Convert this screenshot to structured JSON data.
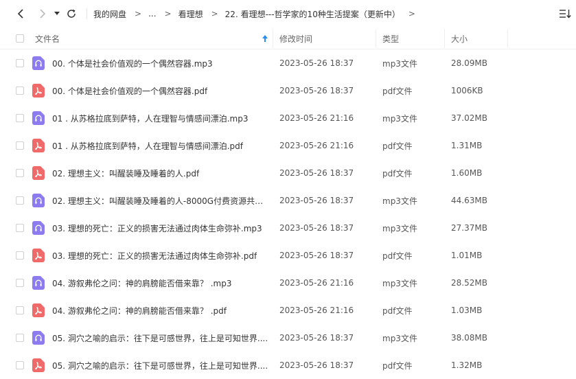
{
  "breadcrumb": {
    "root": "我的网盘",
    "ellipsis": "...",
    "parent": "看理想",
    "current": "22. 看理想---哲学家的10种生活提案（更新中）"
  },
  "columns": {
    "name": "文件名",
    "modified": "修改时间",
    "type": "类型",
    "size": "大小"
  },
  "colors": {
    "audio_icon": "#8c7cf0",
    "pdf_icon": "#f06a6a",
    "sort_arrow": "#2a8cf0"
  },
  "files": [
    {
      "name": "00. 个体是社会价值观的一个偶然容器.mp3",
      "modified": "2023-05-26 18:37",
      "type": "mp3文件",
      "size": "28.09MB",
      "icon": "audio-file-icon"
    },
    {
      "name": "00. 个体是社会价值观的一个偶然容器.pdf",
      "modified": "2023-05-26 18:37",
      "type": "pdf文件",
      "size": "1006KB",
      "icon": "pdf-file-icon"
    },
    {
      "name": "01 . 从苏格拉底到萨特，人在理智与情感间漂泊.mp3",
      "modified": "2023-05-26 21:16",
      "type": "mp3文件",
      "size": "37.02MB",
      "icon": "audio-file-icon"
    },
    {
      "name": "01 . 从苏格拉底到萨特，人在理智与情感间漂泊.pdf",
      "modified": "2023-05-26 21:16",
      "type": "pdf文件",
      "size": "1.31MB",
      "icon": "pdf-file-icon"
    },
    {
      "name": "02. 理想主义：叫醒装睡及睡着的人.pdf",
      "modified": "2023-05-26 18:37",
      "type": "pdf文件",
      "size": "1.60MB",
      "icon": "pdf-file-icon"
    },
    {
      "name": "02. 理想主义：叫醒装睡及睡着的人-8000G付费资源共享...",
      "modified": "2023-05-26 18:37",
      "type": "mp3文件",
      "size": "44.63MB",
      "icon": "audio-file-icon"
    },
    {
      "name": "03. 理想的死亡：正义的损害无法通过肉体生命弥补.mp3",
      "modified": "2023-05-26 18:37",
      "type": "mp3文件",
      "size": "27.37MB",
      "icon": "audio-file-icon"
    },
    {
      "name": "03. 理想的死亡：正义的损害无法通过肉体生命弥补.pdf",
      "modified": "2023-05-26 18:37",
      "type": "pdf文件",
      "size": "1.01MB",
      "icon": "pdf-file-icon"
    },
    {
      "name": "04. 游叙弗伦之问：神的肩膀能否借来靠？ .mp3",
      "modified": "2023-05-26 21:16",
      "type": "mp3文件",
      "size": "28.52MB",
      "icon": "audio-file-icon"
    },
    {
      "name": "04. 游叙弗伦之问：神的肩膀能否借来靠？ .pdf",
      "modified": "2023-05-26 21:16",
      "type": "pdf文件",
      "size": "1.03MB",
      "icon": "pdf-file-icon"
    },
    {
      "name": "05. 洞穴之喻的启示：往下是可感世界，往上是可知世界....",
      "modified": "2023-05-26 18:37",
      "type": "mp3文件",
      "size": "38.08MB",
      "icon": "audio-file-icon"
    },
    {
      "name": "05. 洞穴之喻的启示：往下是可感世界，往上是可知世界....",
      "modified": "2023-05-26 18:37",
      "type": "pdf文件",
      "size": "1.32MB",
      "icon": "pdf-file-icon"
    }
  ]
}
